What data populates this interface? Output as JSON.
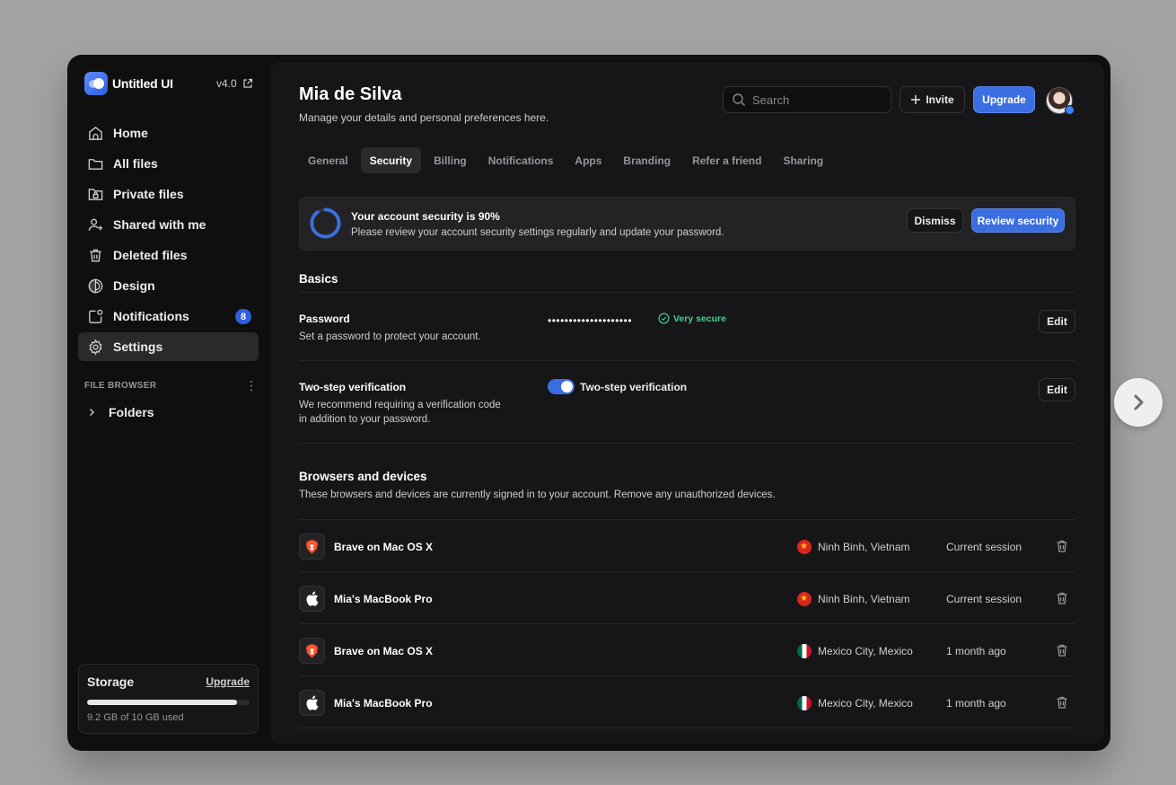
{
  "app": {
    "name": "Untitled UI",
    "version": "v4.0"
  },
  "sidebar": {
    "items": [
      {
        "label": "Home",
        "icon": "home-icon"
      },
      {
        "label": "All files",
        "icon": "folder-icon"
      },
      {
        "label": "Private files",
        "icon": "lock-folder-icon"
      },
      {
        "label": "Shared with me",
        "icon": "users-plus-icon"
      },
      {
        "label": "Deleted files",
        "icon": "trash-icon"
      },
      {
        "label": "Design",
        "icon": "contrast-icon"
      },
      {
        "label": "Notifications",
        "icon": "notification-icon",
        "badge": "8"
      },
      {
        "label": "Settings",
        "icon": "gear-icon",
        "active": true
      }
    ],
    "section_label": "FILE BROWSER",
    "folders_label": "Folders",
    "storage": {
      "title": "Storage",
      "upgrade_label": "Upgrade",
      "used_text": "9.2 GB of 10 GB used",
      "used_fraction": 0.92
    }
  },
  "header": {
    "title": "Mia de Silva",
    "subtitle": "Manage your details and personal preferences here.",
    "search_placeholder": "Search",
    "invite_label": "Invite",
    "upgrade_label": "Upgrade"
  },
  "tabs": [
    {
      "label": "General"
    },
    {
      "label": "Security",
      "active": true
    },
    {
      "label": "Billing"
    },
    {
      "label": "Notifications"
    },
    {
      "label": "Apps"
    },
    {
      "label": "Branding"
    },
    {
      "label": "Refer a friend"
    },
    {
      "label": "Sharing"
    }
  ],
  "banner": {
    "title": "Your account security is 90%",
    "text": "Please review your account security settings regularly and update your password.",
    "progress_percent": 90,
    "dismiss_label": "Dismiss",
    "review_label": "Review security"
  },
  "basics": {
    "title": "Basics",
    "password": {
      "label": "Password",
      "desc": "Set a password to protect your account.",
      "value": "••••••••••••••••••••",
      "strength": "Very secure",
      "edit_label": "Edit"
    },
    "two_step": {
      "label": "Two-step verification",
      "desc": "We recommend requiring a verification code in addition to your password.",
      "toggle_label": "Two-step verification",
      "enabled": true,
      "edit_label": "Edit"
    }
  },
  "devices": {
    "title": "Browsers and devices",
    "desc": "These browsers and devices are currently signed in to your account. Remove any unauthorized devices.",
    "rows": [
      {
        "name": "Brave on Mac OS X",
        "icon": "brave-icon",
        "location": "Ninh Binh, Vietnam",
        "flag": "vietnam-flag-icon",
        "time": "Current session"
      },
      {
        "name": "Mia's MacBook Pro",
        "icon": "apple-icon",
        "location": "Ninh Binh, Vietnam",
        "flag": "vietnam-flag-icon",
        "time": "Current session"
      },
      {
        "name": "Brave on Mac OS X",
        "icon": "brave-icon",
        "location": "Mexico City, Mexico",
        "flag": "mexico-flag-icon",
        "time": "1 month ago"
      },
      {
        "name": "Mia's MacBook Pro",
        "icon": "apple-icon",
        "location": "Mexico City, Mexico",
        "flag": "mexico-flag-icon",
        "time": "1 month ago"
      }
    ]
  },
  "colors": {
    "accent": "#3b6ee0",
    "success": "#47cd89",
    "background": "#0f0f10",
    "panel": "#161618"
  }
}
